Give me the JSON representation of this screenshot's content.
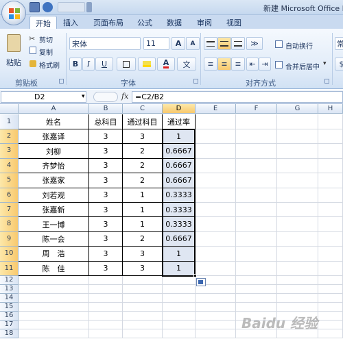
{
  "window": {
    "title": "新建 Microsoft Office Ex"
  },
  "tabs": [
    "开始",
    "插入",
    "页面布局",
    "公式",
    "数据",
    "审阅",
    "视图"
  ],
  "ribbon": {
    "clipboard": {
      "paste": "粘贴",
      "cut": "剪切",
      "copy": "复制",
      "format_painter": "格式刷",
      "label": "剪贴板"
    },
    "font": {
      "name": "宋体",
      "size": "11",
      "grow": "A",
      "shrink": "A",
      "bold": "B",
      "italic": "I",
      "underline": "U",
      "phonetic": "文",
      "label": "字体"
    },
    "alignment": {
      "wrap": "自动换行",
      "merge": "合并后居中",
      "label": "对齐方式"
    },
    "number": {
      "format": "常"
    }
  },
  "formula_bar": {
    "cell_ref": "D2",
    "fx": "fx",
    "formula": "=C2/B2"
  },
  "columns": [
    "A",
    "B",
    "C",
    "D",
    "E",
    "F",
    "G",
    "H"
  ],
  "rows": [
    "1",
    "2",
    "3",
    "4",
    "5",
    "6",
    "7",
    "8",
    "9",
    "10",
    "11",
    "12",
    "13",
    "14",
    "15",
    "16",
    "17",
    "18"
  ],
  "table": {
    "headers": [
      "姓名",
      "总科目",
      "通过科目",
      "通过率"
    ],
    "data": [
      [
        "张嘉译",
        "3",
        "3",
        "1"
      ],
      [
        "刘柳",
        "3",
        "2",
        "0.6667"
      ],
      [
        "齐梦怡",
        "3",
        "2",
        "0.6667"
      ],
      [
        "张嘉家",
        "3",
        "2",
        "0.6667"
      ],
      [
        "刘若观",
        "3",
        "1",
        "0.3333"
      ],
      [
        "张嘉新",
        "3",
        "1",
        "0.3333"
      ],
      [
        "王一博",
        "3",
        "1",
        "0.3333"
      ],
      [
        "陈一会",
        "3",
        "2",
        "0.6667"
      ],
      [
        "周　浩",
        "3",
        "3",
        "1"
      ],
      [
        "陈　佳",
        "3",
        "3",
        "1"
      ]
    ]
  },
  "watermark": "Baidu 经验"
}
